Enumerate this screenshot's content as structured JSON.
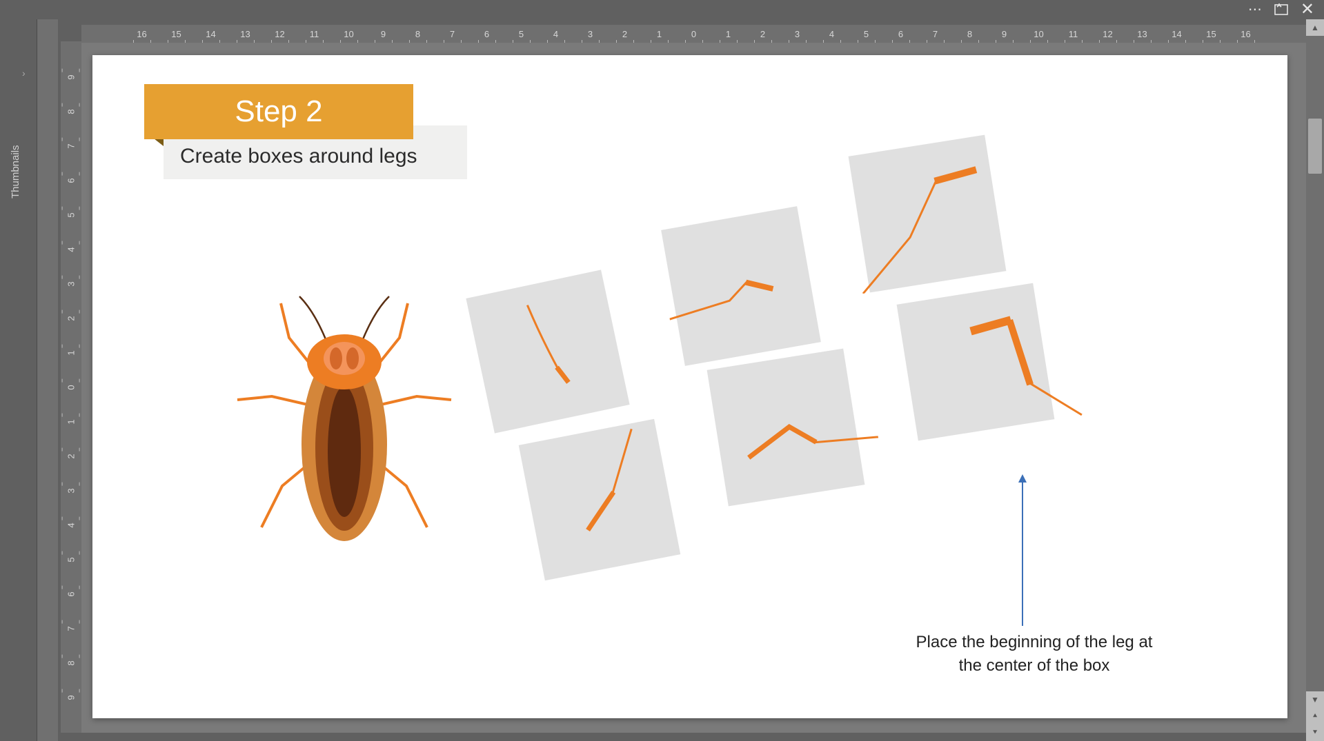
{
  "app": {
    "thumbnails_label": "Thumbnails"
  },
  "ruler": {
    "h": [
      "16",
      "15",
      "14",
      "13",
      "12",
      "11",
      "10",
      "9",
      "8",
      "7",
      "6",
      "5",
      "4",
      "3",
      "2",
      "1",
      "0",
      "1",
      "2",
      "3",
      "4",
      "5",
      "6",
      "7",
      "8",
      "9",
      "10",
      "11",
      "12",
      "13",
      "14",
      "15",
      "16"
    ],
    "v": [
      "9",
      "8",
      "7",
      "6",
      "5",
      "4",
      "3",
      "2",
      "1",
      "0",
      "1",
      "2",
      "3",
      "4",
      "5",
      "6",
      "7",
      "8",
      "9"
    ]
  },
  "slide": {
    "step_label": "Step 2",
    "subtitle": "Create boxes around legs",
    "annotation": "Place the beginning of the leg at the center of the box"
  },
  "colors": {
    "accent": "#e6a031",
    "leg": "#ed7d23",
    "arrow": "#3b6fb7"
  }
}
